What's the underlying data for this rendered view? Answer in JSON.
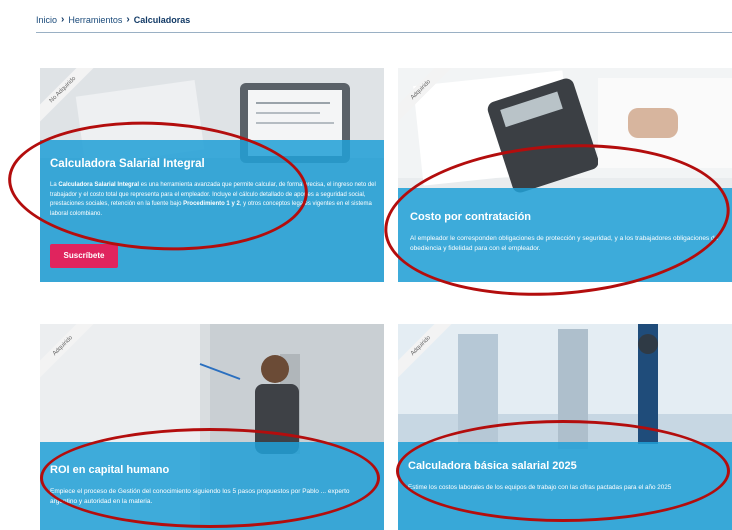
{
  "breadcrumb": {
    "items": [
      "Inicio",
      "Herramientos",
      "Calculadoras"
    ],
    "separator": "›"
  },
  "cards": [
    {
      "ribbon": "No Adquirido",
      "title": "Calculadora Salarial Integral",
      "desc_parts": {
        "p1": "La ",
        "b1": "Calculadora Salarial Integral",
        "p2": " es una herramienta avanzada que permite calcular, de forma precisa, el ingreso neto del trabajador y el costo total que representa para el empleador. Incluye el cálculo detallado de aportes a seguridad social, prestaciones sociales, retención en la fuente bajo ",
        "b2": "Procedimiento 1 y 2",
        "p3": ", y otros conceptos legales vigentes en el sistema laboral colombiano."
      },
      "button": "Suscríbete"
    },
    {
      "ribbon": "Adquirido",
      "title": "Costo por contratación",
      "desc": "Al empleador le corresponden obligaciones de protección y seguridad, y a los trabajadores obligaciones de obediencia y fidelidad para con el empleador."
    },
    {
      "ribbon": "Adquirido",
      "title": "ROI en capital humano",
      "desc": "Empiece el proceso de Gestión del conocimiento siguiendo los 5 pasos propuestos por Pablo ... experto argentino y autoridad en la materia."
    },
    {
      "ribbon": "Adquirido",
      "title": "Calculadora básica salarial 2025",
      "desc": "Estime los costos laborales de los equipos de trabajo con las cifras pactadas para el año 2025"
    }
  ],
  "colors": {
    "overlay": "#21a0d6",
    "button": "#e0245e",
    "annotation": "#b30d0d"
  }
}
